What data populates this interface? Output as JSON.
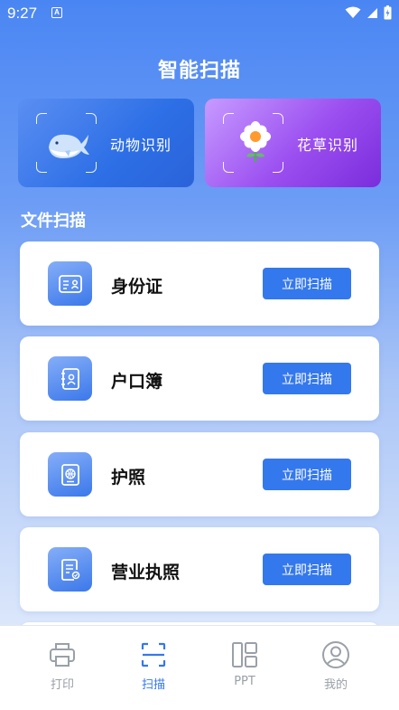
{
  "status_bar": {
    "time": "9:27",
    "badge": "A"
  },
  "header": {
    "title": "智能扫描"
  },
  "features": [
    {
      "label": "动物识别",
      "icon": "whale-icon"
    },
    {
      "label": "花草识别",
      "icon": "flower-icon"
    }
  ],
  "section": {
    "title": "文件扫描"
  },
  "scan_items": [
    {
      "label": "身份证",
      "button": "立即扫描",
      "icon": "id-card-icon"
    },
    {
      "label": "户口簿",
      "button": "立即扫描",
      "icon": "household-book-icon"
    },
    {
      "label": "护照",
      "button": "立即扫描",
      "icon": "passport-icon"
    },
    {
      "label": "营业执照",
      "button": "立即扫描",
      "icon": "business-license-icon"
    }
  ],
  "nav": [
    {
      "label": "打印",
      "icon": "printer-icon",
      "active": false
    },
    {
      "label": "扫描",
      "icon": "scan-icon",
      "active": true
    },
    {
      "label": "PPT",
      "icon": "layout-icon",
      "active": false
    },
    {
      "label": "我的",
      "icon": "user-icon",
      "active": false
    }
  ],
  "colors": {
    "primary": "#3478ed",
    "nav_inactive": "#9aa0a8"
  }
}
